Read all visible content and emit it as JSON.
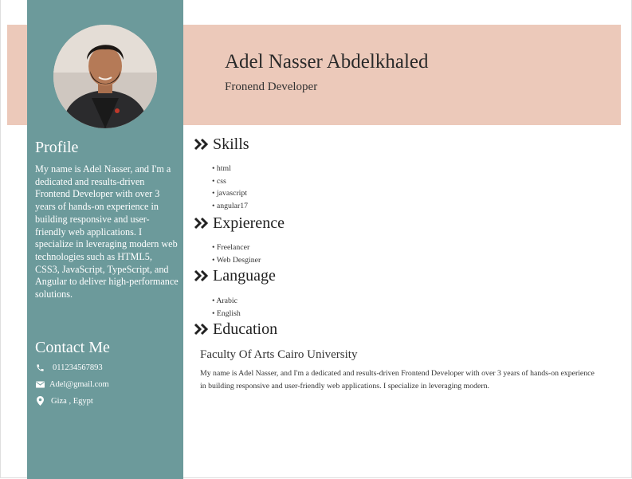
{
  "header": {
    "name": "Adel Nasser Abdelkhaled",
    "role": "Fronend Developer"
  },
  "sidebar": {
    "profile_heading": "Profile",
    "profile_text": "My name is Adel Nasser, and I'm a dedicated and results-driven Frontend Developer with over 3 years of hands-on experience in building responsive and user-friendly web applications. I specialize in leveraging modern web technologies such as HTML5, CSS3, JavaScript, TypeScript, and Angular to deliver high-performance solutions.",
    "contact_heading": "Contact Me",
    "contact": {
      "phone": "011234567893",
      "email": "Adel@gmail.com",
      "location": "Giza , Egypt"
    }
  },
  "sections": {
    "skills": {
      "heading": "Skills",
      "items": [
        "html",
        "css",
        "javascript",
        "angular17"
      ]
    },
    "experience": {
      "heading": "Expierence",
      "items": [
        "Freelancer",
        "Web Desginer"
      ]
    },
    "language": {
      "heading": "Language",
      "items": [
        "Arabic",
        "English"
      ]
    },
    "education": {
      "heading": "Education",
      "title": "Faculty Of Arts Cairo University",
      "description": "My name is Adel Nasser, and I'm a dedicated and results-driven Frontend Developer with over 3 years of hands-on experience in building responsive and user-friendly web applications. I specialize in leveraging modern."
    }
  },
  "colors": {
    "sidebar": "#6c9a9b",
    "header_band": "#ecc9ba"
  },
  "icons": {
    "phone": "phone-icon",
    "email": "envelope-icon",
    "location": "map-pin-icon",
    "section": "double-chevron-right-icon"
  }
}
